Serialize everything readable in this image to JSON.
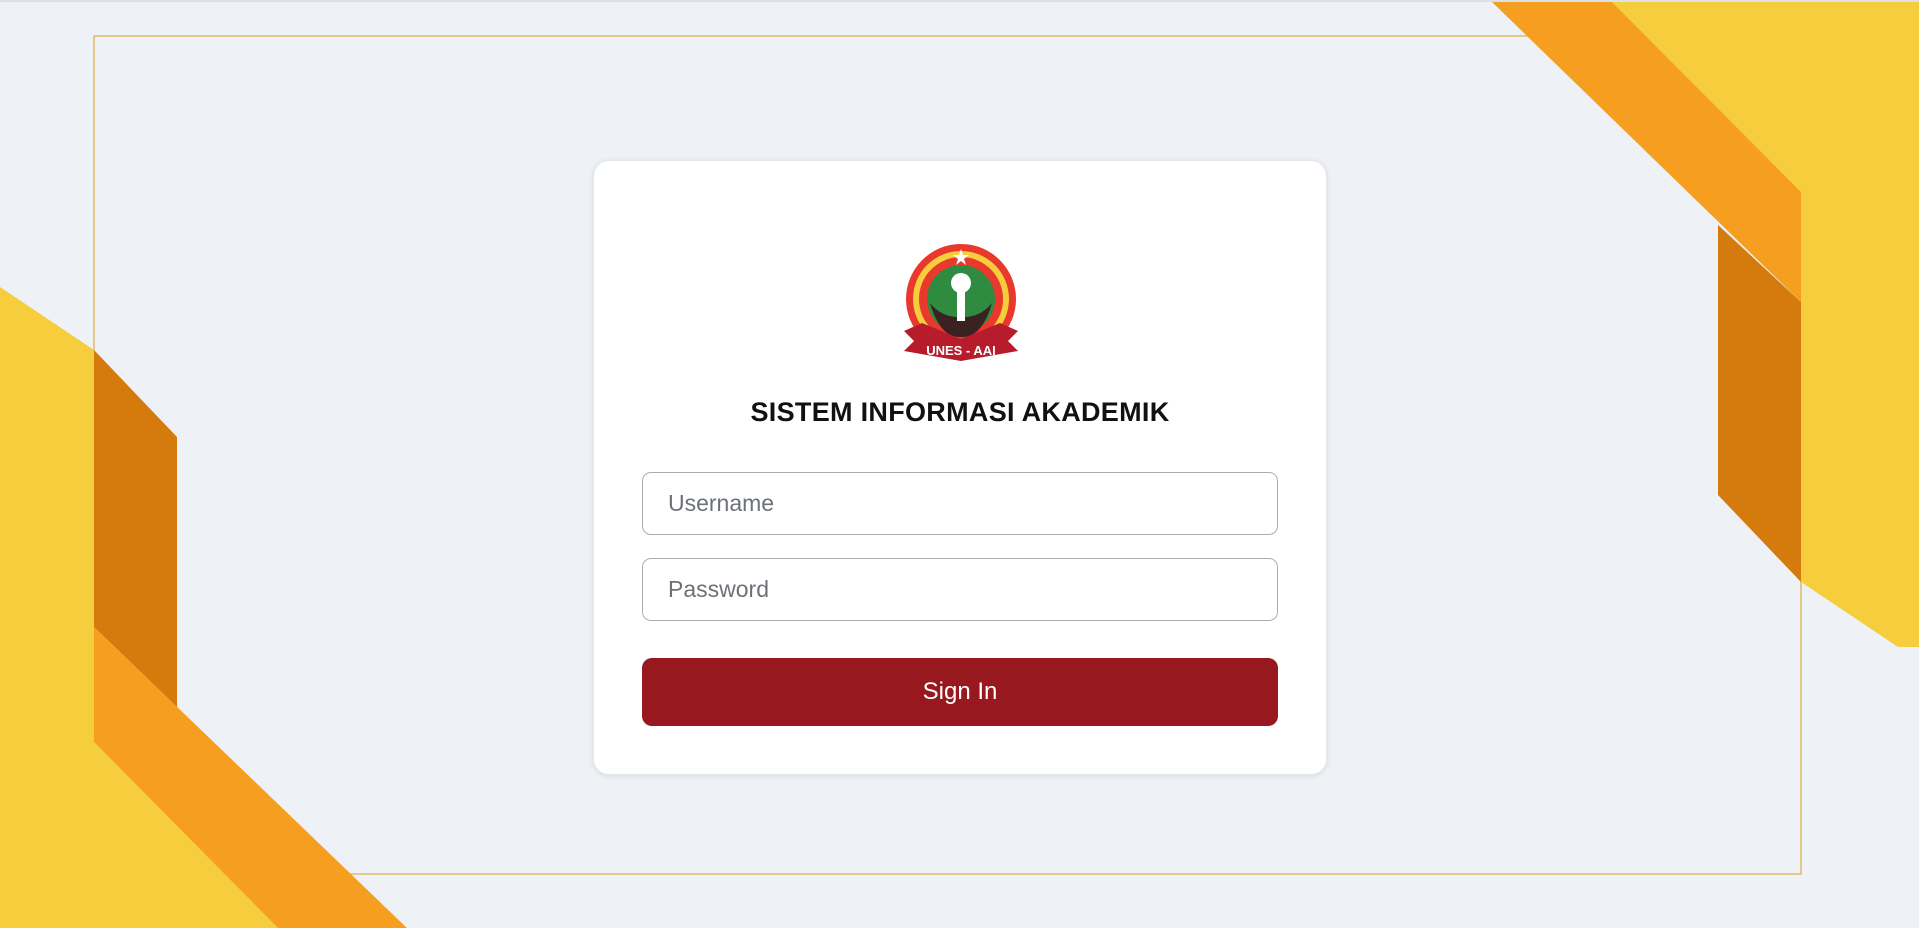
{
  "app": {
    "title": "SISTEM INFORMASI AKADEMIK",
    "logo_text": "UNES - AAI"
  },
  "login": {
    "username_placeholder": "Username",
    "password_placeholder": "Password",
    "signin_label": "Sign In"
  },
  "colors": {
    "background": "#eef1f5",
    "accent_yellow": "#f6cd3d",
    "accent_orange": "#f59e1f",
    "accent_dark_orange": "#d57b0e",
    "button": "#97191f",
    "frame_line": "#e0b96a"
  }
}
